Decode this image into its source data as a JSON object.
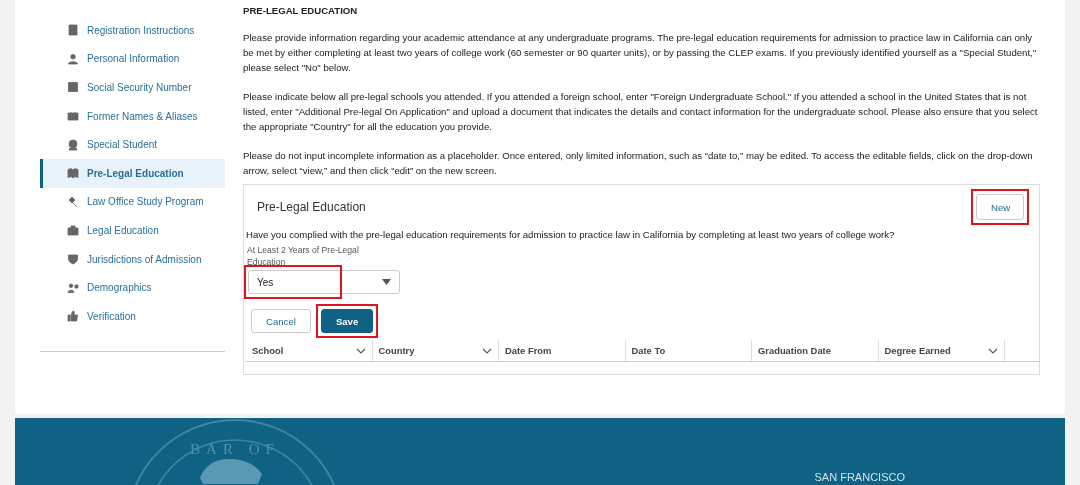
{
  "sidebar": {
    "items": [
      {
        "label": "Registration Instructions",
        "selected": false
      },
      {
        "label": "Personal Information",
        "selected": false
      },
      {
        "label": "Social Security Number",
        "selected": false
      },
      {
        "label": "Former Names & Aliases",
        "selected": false
      },
      {
        "label": "Special Student",
        "selected": false
      },
      {
        "label": "Pre-Legal Education",
        "selected": true
      },
      {
        "label": "Law Office Study Program",
        "selected": false
      },
      {
        "label": "Legal Education",
        "selected": false
      },
      {
        "label": "Jurisdictions of Admission",
        "selected": false
      },
      {
        "label": "Demographics",
        "selected": false
      },
      {
        "label": "Verification",
        "selected": false
      }
    ]
  },
  "main": {
    "heading": "PRE-LEGAL EDUCATION",
    "paragraphs": [
      "Please provide information regarding your academic attendance at any undergraduate programs. The pre-legal education requirements for admission to practice law in California can only be met by either completing at least two years of college work (60 semester or 90 quarter units), or by passing the CLEP exams. If you previously identified yourself as a \"Special Student,\" please select \"No\" below.",
      "Please indicate below all pre-legal schools you attended. If you attended a foreign school, enter \"Foreign Undergraduate School.\" If you attended a school in the United States that is not listed, enter \"Additional Pre-legal On Application\" and upload a document that indicates the details and contact information for the undergraduate school. Please also ensure that you select the appropriate \"Country\" for all the education you provide.",
      "Please do not input incomplete information as a placeholder. Once entered, only limited information, such as “date to,” may be edited. To access the editable fields, click on the drop-down arrow, select “view,” and then click “edit” on the new screen."
    ]
  },
  "card": {
    "title": "Pre-Legal Education",
    "new_button": {
      "label": "New",
      "highlighted": true
    },
    "question": "Have you complied with the pre-legal education requirements for admission to practice law in California by completing at least two years of college work?",
    "select": {
      "label": "At Least 2 Years of Pre-Legal Education",
      "value": "Yes",
      "highlighted": true
    },
    "buttons": [
      {
        "label": "Cancel",
        "kind": "secondary",
        "highlighted": false
      },
      {
        "label": "Save",
        "kind": "primary",
        "highlighted": true
      }
    ],
    "table": {
      "columns": [
        {
          "label": "School",
          "sortable": true
        },
        {
          "label": "Country",
          "sortable": true
        },
        {
          "label": "Date From",
          "sortable": false
        },
        {
          "label": "Date To",
          "sortable": false
        },
        {
          "label": "Graduation Date",
          "sortable": false
        },
        {
          "label": "Degree Earned",
          "sortable": true
        }
      ]
    }
  },
  "footer": {
    "seal_text": "BAR OF",
    "city": "SAN FRANCISCO"
  }
}
